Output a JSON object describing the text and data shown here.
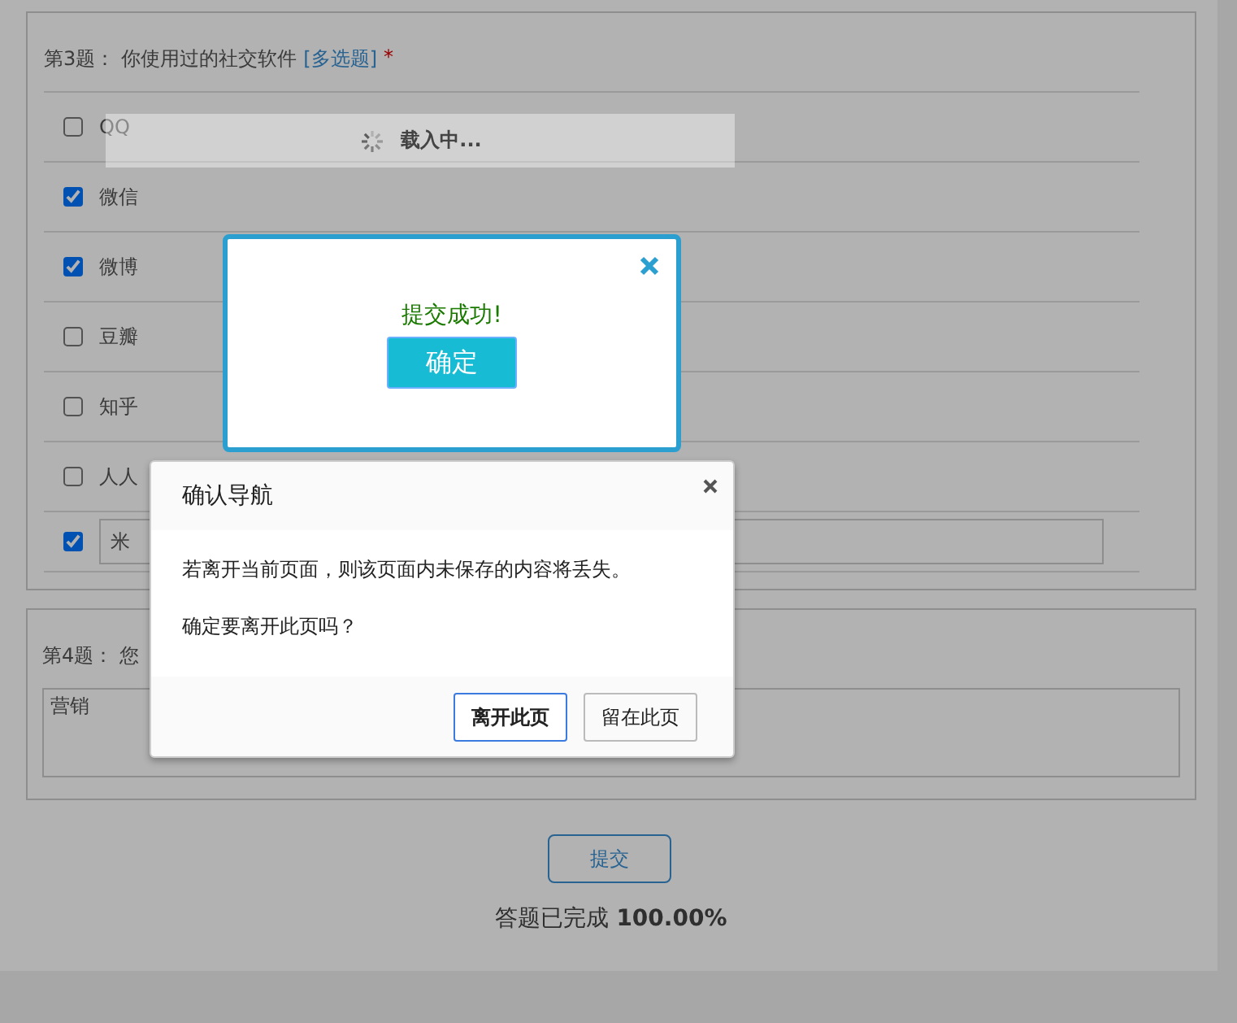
{
  "question_3": {
    "number": "第3题：",
    "title": "你使用过的社交软件",
    "type_tag": "[多选题]",
    "required_mark": "*",
    "options": [
      {
        "kind": "text",
        "label": "QQ",
        "checked": false
      },
      {
        "kind": "text",
        "label": "微信",
        "checked": true
      },
      {
        "kind": "text",
        "label": "微博",
        "checked": true
      },
      {
        "kind": "text",
        "label": "豆瓣",
        "checked": false
      },
      {
        "kind": "text",
        "label": "知乎",
        "checked": false
      },
      {
        "kind": "text",
        "label": "人人",
        "checked": false
      },
      {
        "kind": "input",
        "value": "米",
        "checked": true
      }
    ]
  },
  "question_4": {
    "number": "第4题：",
    "title": "您",
    "answer": "营销"
  },
  "submit_button": "提交",
  "progress": {
    "label": "答题已完成",
    "value": "100.00%"
  },
  "loading": {
    "text": "载入中..."
  },
  "success_dialog": {
    "message": "提交成功!",
    "button": "确定"
  },
  "confirm_dialog": {
    "title": "确认导航",
    "paragraphs": [
      "若离开当前页面，则该页面内未保存的内容将丢失。",
      "确定要离开此页吗？"
    ],
    "buttons": [
      {
        "label": "离开此页",
        "focused": true
      },
      {
        "label": "留在此页",
        "focused": false
      }
    ]
  }
}
